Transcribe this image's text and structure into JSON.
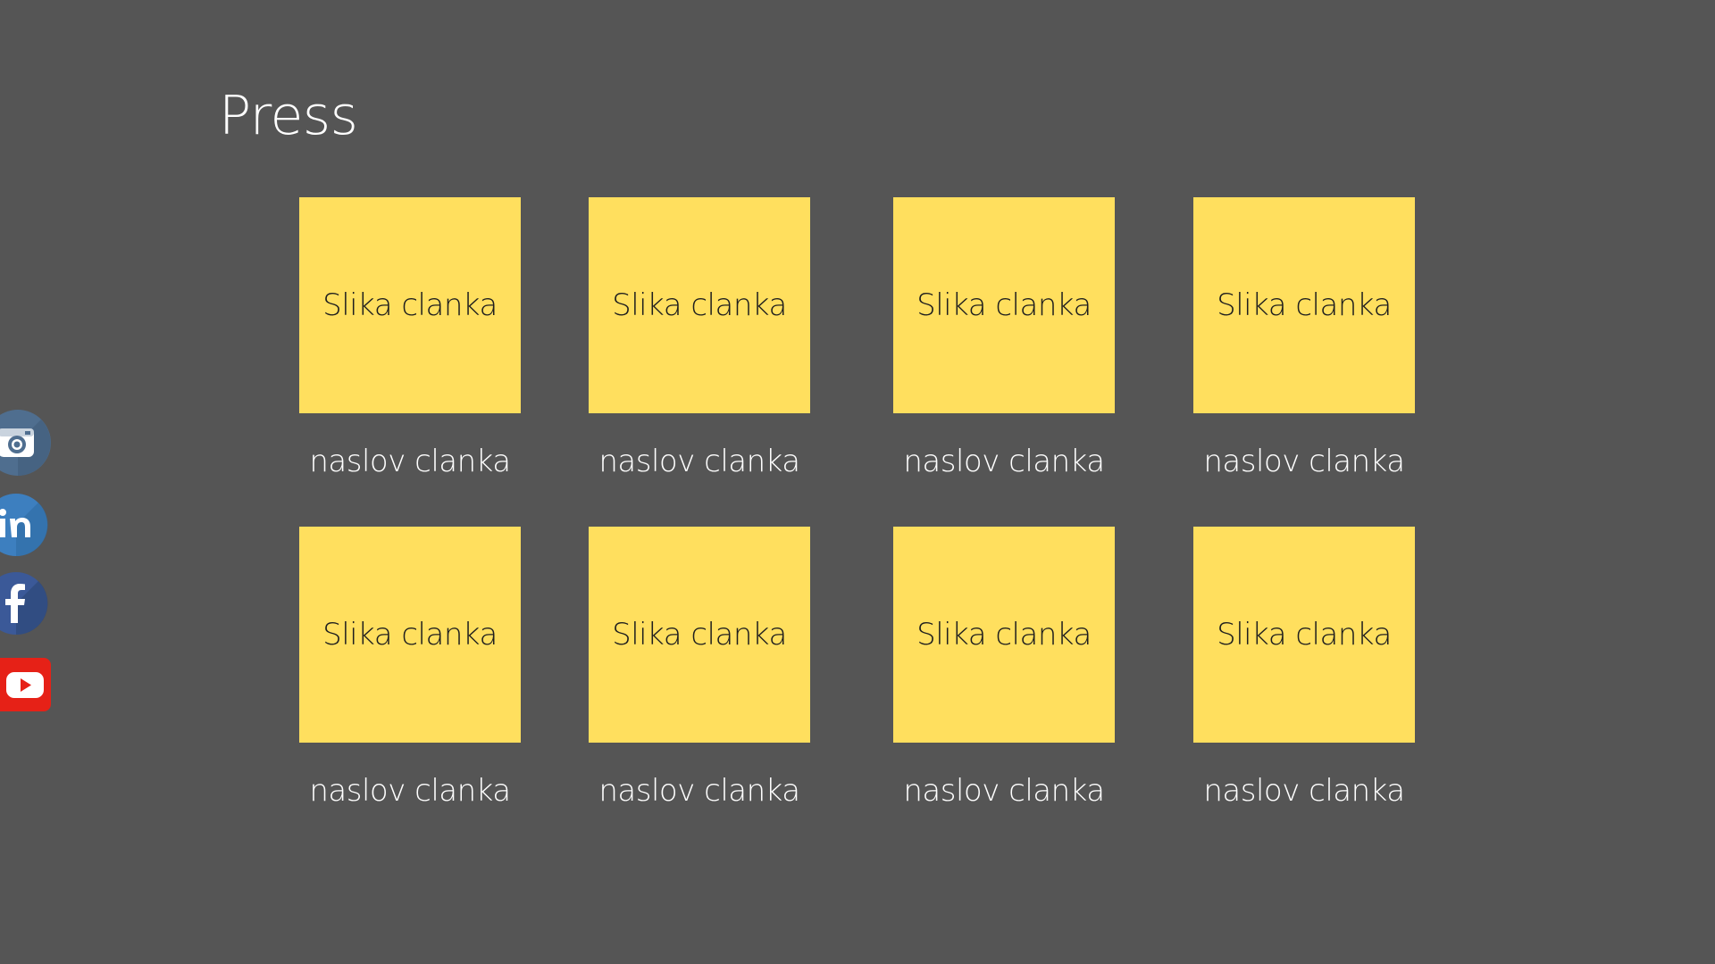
{
  "page": {
    "title": "Press"
  },
  "colors": {
    "background": "#555555",
    "card": "#ffdf5e",
    "card_text": "#1e1e1e",
    "text": "#ffffff",
    "instagram": "#4f6e8f",
    "linkedin": "#3d7fbf",
    "facebook": "#3b5998",
    "youtube": "#e62117"
  },
  "social": [
    {
      "name": "instagram",
      "icon": "instagram-icon"
    },
    {
      "name": "linkedin",
      "icon": "linkedin-icon"
    },
    {
      "name": "facebook",
      "icon": "facebook-icon"
    },
    {
      "name": "youtube",
      "icon": "youtube-icon"
    }
  ],
  "articles": [
    {
      "image_label": "Slika clanka",
      "title": "naslov clanka"
    },
    {
      "image_label": "Slika clanka",
      "title": "naslov clanka"
    },
    {
      "image_label": "Slika clanka",
      "title": "naslov clanka"
    },
    {
      "image_label": "Slika clanka",
      "title": "naslov clanka"
    },
    {
      "image_label": "Slika clanka",
      "title": "naslov clanka"
    },
    {
      "image_label": "Slika clanka",
      "title": "naslov clanka"
    },
    {
      "image_label": "Slika clanka",
      "title": "naslov clanka"
    },
    {
      "image_label": "Slika clanka",
      "title": "naslov clanka"
    }
  ]
}
